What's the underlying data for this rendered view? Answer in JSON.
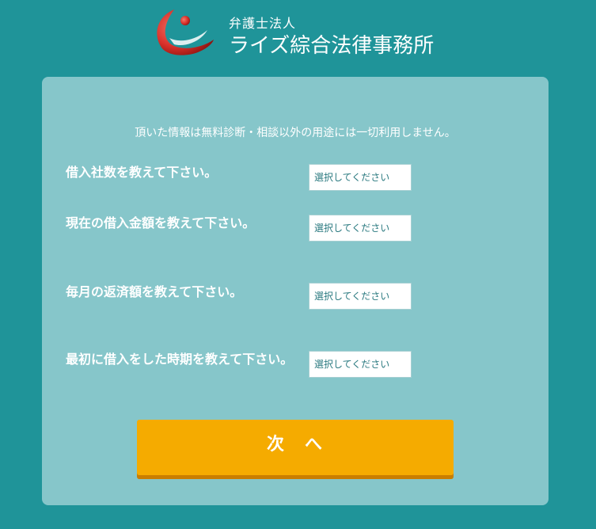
{
  "header": {
    "firm_type": "弁護士法人",
    "firm_name": "ライズ綜合法律事務所",
    "logo_icon": "rise-logo-icon"
  },
  "form": {
    "notice": "頂いた情報は無料診断・相談以外の用途には一切利用しません。",
    "questions": [
      {
        "label": "借入社数を教えて下さい。",
        "selected": "選択してください"
      },
      {
        "label": "現在の借入金額を教えて下さい。",
        "selected": "選択してください"
      },
      {
        "label": "毎月の返済額を教えて下さい。",
        "selected": "選択してください"
      },
      {
        "label": "最初に借入をした時期を教えて下さい。",
        "selected": "選択してください"
      }
    ],
    "next_label": "次　へ"
  },
  "colors": {
    "background": "#1f9499",
    "card": "#86c6ca",
    "button": "#f5ab00",
    "button_shadow": "#c97e00"
  }
}
